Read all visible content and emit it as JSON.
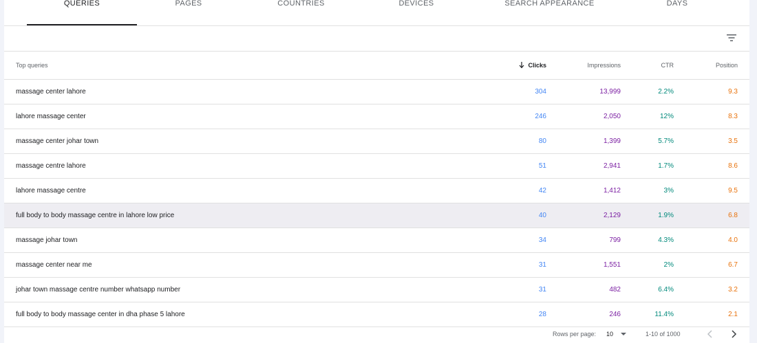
{
  "tabs": [
    {
      "label": "QUERIES",
      "active": true
    },
    {
      "label": "PAGES",
      "active": false
    },
    {
      "label": "COUNTRIES",
      "active": false
    },
    {
      "label": "DEVICES",
      "active": false
    },
    {
      "label": "SEARCH APPEARANCE",
      "active": false
    },
    {
      "label": "DAYS",
      "active": false
    }
  ],
  "table": {
    "headers": {
      "query": "Top queries",
      "clicks": "Clicks",
      "impressions": "Impressions",
      "ctr": "CTR",
      "position": "Position"
    },
    "sort": {
      "column": "clicks",
      "direction": "descending"
    },
    "highlighted_row": 5,
    "rows": [
      {
        "query": "massage center lahore",
        "clicks": "304",
        "impressions": "13,999",
        "ctr": "2.2%",
        "position": "9.3"
      },
      {
        "query": "lahore massage center",
        "clicks": "246",
        "impressions": "2,050",
        "ctr": "12%",
        "position": "8.3"
      },
      {
        "query": "massage center johar town",
        "clicks": "80",
        "impressions": "1,399",
        "ctr": "5.7%",
        "position": "3.5"
      },
      {
        "query": "massage centre lahore",
        "clicks": "51",
        "impressions": "2,941",
        "ctr": "1.7%",
        "position": "8.6"
      },
      {
        "query": "lahore massage centre",
        "clicks": "42",
        "impressions": "1,412",
        "ctr": "3%",
        "position": "9.5"
      },
      {
        "query": "full body to body massage centre in lahore low price",
        "clicks": "40",
        "impressions": "2,129",
        "ctr": "1.9%",
        "position": "6.8"
      },
      {
        "query": "massage johar town",
        "clicks": "34",
        "impressions": "799",
        "ctr": "4.3%",
        "position": "4.0"
      },
      {
        "query": "massage center near me",
        "clicks": "31",
        "impressions": "1,551",
        "ctr": "2%",
        "position": "6.7"
      },
      {
        "query": "johar town massage centre number whatsapp number",
        "clicks": "31",
        "impressions": "482",
        "ctr": "6.4%",
        "position": "3.2"
      },
      {
        "query": "full body to body massage center in dha phase 5 lahore",
        "clicks": "28",
        "impressions": "246",
        "ctr": "11.4%",
        "position": "2.1"
      }
    ]
  },
  "footer": {
    "rows_per_page_label": "Rows per page:",
    "rows_per_page_value": "10",
    "range_text": "1-10 of 1000"
  },
  "icons": {
    "filter": "filter-icon",
    "sort": "arrow-down-icon",
    "dropdown": "caret-down-icon",
    "prev": "chevron-left-icon",
    "next": "chevron-right-icon"
  },
  "colors": {
    "clicks": "#4285f4",
    "impressions": "#7b1fa2",
    "ctr": "#00897b",
    "position": "#e8710a",
    "highlight_row": "#eeedf2"
  }
}
